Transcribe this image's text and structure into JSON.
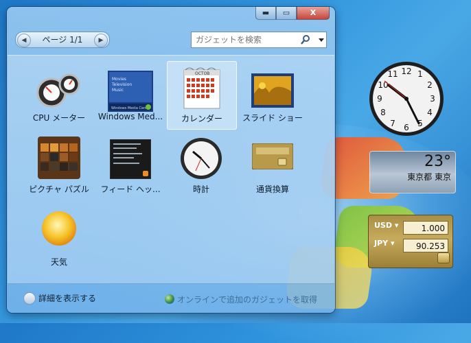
{
  "window": {
    "controls": {
      "minimize": "▬",
      "maximize": "▭",
      "close": "X"
    }
  },
  "toolbar": {
    "page_label": "ページ 1/1",
    "prev_arrow": "◀",
    "next_arrow": "▶",
    "search_placeholder": "ガジェットを検索"
  },
  "gadgets": [
    {
      "label": "CPU メーター",
      "icon": "cpu-meter-icon"
    },
    {
      "label": "Windows Med...",
      "icon": "media-center-icon"
    },
    {
      "label": "カレンダー",
      "icon": "calendar-icon",
      "selected": true
    },
    {
      "label": "スライド ショー",
      "icon": "slideshow-icon"
    },
    {
      "label": "ピクチャ パズル",
      "icon": "picture-puzzle-icon"
    },
    {
      "label": "フィード ヘッ...",
      "icon": "feed-headlines-icon"
    },
    {
      "label": "時計",
      "icon": "clock-icon"
    },
    {
      "label": "通貨換算",
      "icon": "currency-icon"
    },
    {
      "label": "天気",
      "icon": "weather-sun-icon"
    }
  ],
  "footer": {
    "details_label": "詳細を表示する",
    "online_link": "オンラインで追加のガジェットを取得"
  },
  "calendar_icon": {
    "month": "OCTOB"
  },
  "media_center_icon": {
    "lines": [
      "Movies",
      "Television",
      "Music"
    ],
    "bar": "Windows Media Center"
  },
  "sidebar": {
    "weather": {
      "temperature": "23°",
      "city": "東京都 東京"
    },
    "currency": {
      "rows": [
        {
          "code": "USD ▾",
          "value": "1.000"
        },
        {
          "code": "JPY ▾",
          "value": "90.253"
        }
      ]
    }
  },
  "colors": {
    "accent": "#2f93dd",
    "window_glass": "#96c8f0",
    "currency_gold": "#c6ab5c"
  }
}
